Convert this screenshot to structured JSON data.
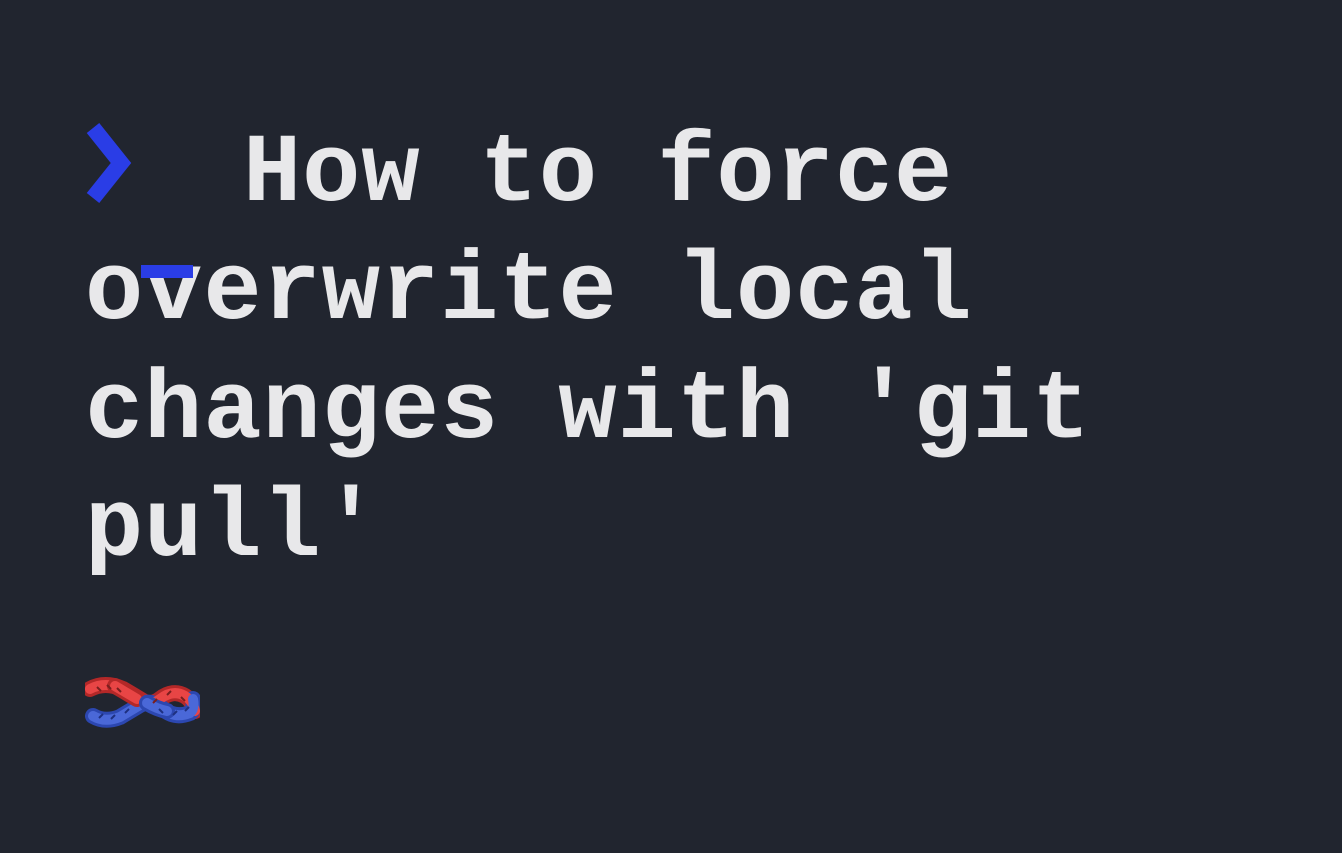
{
  "title": "How to force overwrite local changes with 'git pull'",
  "icons": {
    "prompt": "terminal-prompt-icon",
    "knot": "knot-icon"
  },
  "colors": {
    "background": "#21252f",
    "text": "#e8e8ea",
    "accent": "#2a3de6",
    "knot_red": "#d93939",
    "knot_blue": "#3a5ad0"
  }
}
